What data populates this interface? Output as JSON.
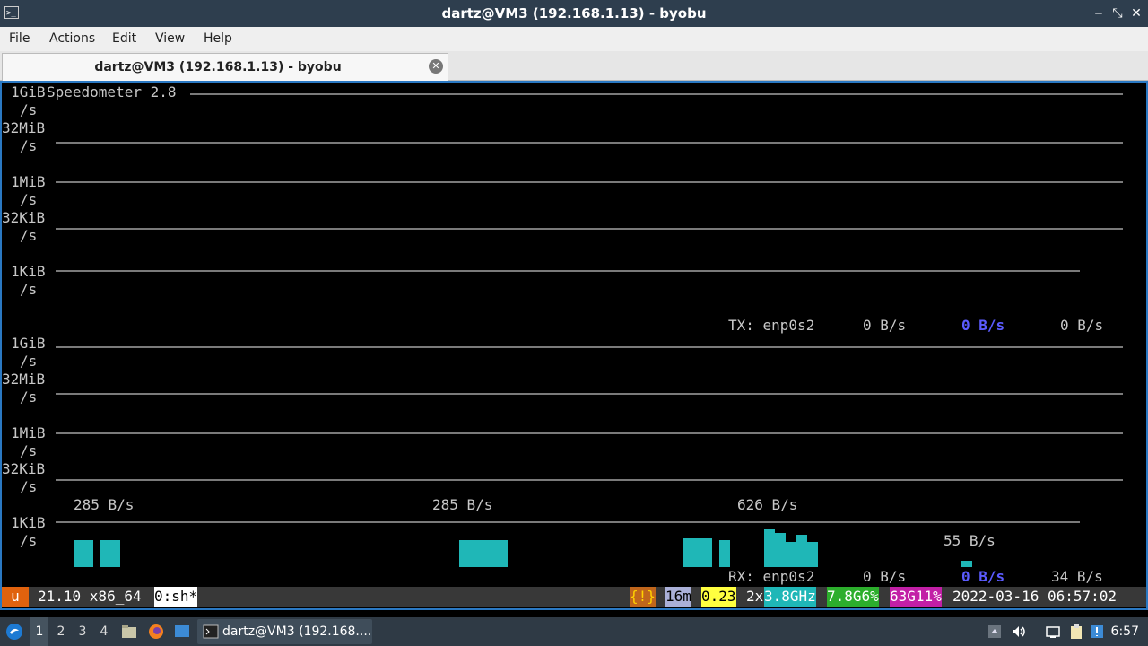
{
  "window": {
    "title": "dartz@VM3 (192.168.1.13) - byobu",
    "minimize": "‒",
    "restore": "⤡",
    "close": "✕"
  },
  "menu": [
    "File",
    "Actions",
    "Edit",
    "View",
    "Help"
  ],
  "tab": {
    "label": "dartz@VM3 (192.168.1.13) - byobu",
    "close": "✕"
  },
  "speedometer": {
    "title": "Speedometer 2.8",
    "tx_axis": [
      "1GiB",
      "/s",
      "32MiB",
      "/s",
      "1MiB",
      "/s",
      "32KiB",
      "/s",
      "1KiB",
      "/s"
    ],
    "rx_axis": [
      "1GiB",
      "/s",
      "32MiB",
      "/s",
      "1MiB",
      "/s",
      "32KiB",
      "/s",
      "1KiB",
      "/s"
    ],
    "tx": {
      "label": "TX: enp0s2",
      "v1": "0 B/s",
      "v2": "0 B/s",
      "v3": "0 B/s"
    },
    "rx": {
      "label": "RX: enp0s2",
      "v1": "0 B/s",
      "v2": "0 B/s",
      "v3": "34 B/s"
    },
    "peaks": [
      "285 B/s",
      "285 B/s",
      "626 B/s",
      "55 B/s"
    ]
  },
  "status": {
    "u": "u",
    "release": "21.10 x86_64",
    "window": "0:sh*",
    "alert": "{!}",
    "uptime": "16m",
    "load": "0.23",
    "cpu_count": "2x",
    "cpu_freq": "3.8GHz",
    "mem": "7.8G6%",
    "disk": "63G11%",
    "datetime": "2022-03-16 06:57:02"
  },
  "taskbar": {
    "workspaces": [
      "1",
      "2",
      "3",
      "4"
    ],
    "task_label": "dartz@VM3 (192.168....",
    "clock": "6:57"
  },
  "colors": {
    "accent": "#2a78c2",
    "graph": "#1fb7b7",
    "blue_value": "#5b5bff"
  }
}
